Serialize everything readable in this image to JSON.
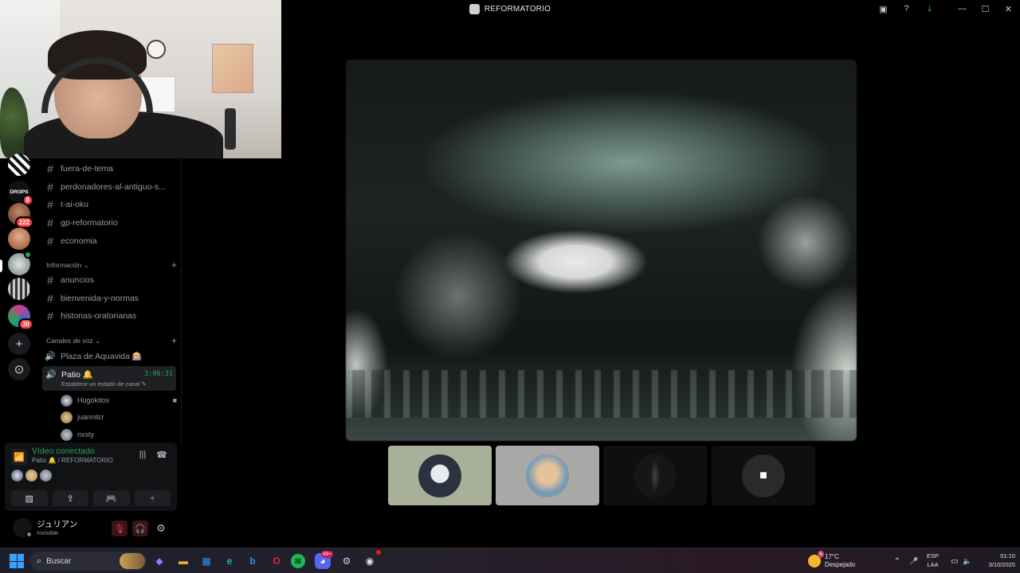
{
  "window": {
    "title": "REFORMATORIO",
    "controls": {
      "inbox": "▣",
      "help": "?",
      "download": "⤓",
      "minimize": "—",
      "maximize": "☐",
      "close": "✕"
    }
  },
  "servers": [
    {
      "name": "server-1",
      "badge": "",
      "color": "#e8e8e8"
    },
    {
      "name": "server-drops",
      "label": "DROPS",
      "badge": "8",
      "color": "#111111"
    },
    {
      "name": "server-3",
      "badge": "222",
      "color": "#a0634a"
    },
    {
      "name": "server-4",
      "badge": "",
      "color": "#b7552c"
    },
    {
      "name": "server-5",
      "badge": "",
      "color": "#9aa6a0",
      "active": true
    },
    {
      "name": "server-6",
      "badge": "",
      "color": "#6b6b6b"
    },
    {
      "name": "server-7",
      "badge": "30",
      "color": "#7b3b8a"
    }
  ],
  "rail_buttons": {
    "add": "+",
    "explore": "⊙"
  },
  "channels_top": [
    {
      "name": "fuera-de-tema"
    },
    {
      "name": "perdonadores-al-antiguo-s..."
    },
    {
      "name": "t-ai-oku"
    },
    {
      "name": "gp-reformatorio"
    },
    {
      "name": "economia"
    }
  ],
  "category_info": {
    "label": "Información ⌄",
    "plus": "+"
  },
  "channels_info": [
    {
      "name": "anuncios"
    },
    {
      "name": "bienvenida-y-normas"
    },
    {
      "name": "historias-oratorianas"
    }
  ],
  "category_voice": {
    "label": "Canales de voz ⌄",
    "plus": "+"
  },
  "voice_channels": [
    {
      "name": "Plaza de Aquavida 🎰"
    }
  ],
  "active_voice": {
    "name": "Patio 🔔",
    "timer": "3:06:31",
    "status": "Establece un estado de canal ✎",
    "users": [
      {
        "name": "Hugokitos",
        "camera": true,
        "color": "#3a4a6a"
      },
      {
        "name": "juannilcr",
        "camera": false,
        "color": "#a88a5a"
      },
      {
        "name": "nxsty",
        "camera": false,
        "color": "#5a6a7a"
      }
    ]
  },
  "voice_panel": {
    "title": "Vídeo conectado",
    "subtitle": "Patio 🔔 / REFORMATORIO",
    "signal_icon": "📶",
    "noise_icon": "|||",
    "disconnect_icon": "☎",
    "avatars": [
      "#3a4a6a",
      "#a88a5a",
      "#5a6a7a"
    ],
    "buttons": [
      {
        "name": "camera-off-button",
        "icon": "▨"
      },
      {
        "name": "share-screen-button",
        "icon": "⇪"
      },
      {
        "name": "activities-button",
        "icon": "🎮"
      },
      {
        "name": "soundboard-button",
        "icon": "✦",
        "dim": true
      }
    ]
  },
  "user": {
    "name": "ジュリアン",
    "status": "Invisible",
    "mic_icon": "🎙",
    "deafen_icon": "🎧",
    "settings_icon": "⚙"
  },
  "stage": {
    "description_hidden": ""
  },
  "tiles": [
    {
      "name": "tile-1",
      "bg": "#a9b09a",
      "avatar": "#2b3340"
    },
    {
      "name": "tile-2",
      "bg": "#a8a8a6",
      "avatar": "#c69a6a"
    },
    {
      "name": "tile-3",
      "bg": "#0f0f0f",
      "avatar": "#161616"
    },
    {
      "name": "tile-4",
      "bg": "#0f0f0f",
      "avatar": "#2a2a2a",
      "icon": "■"
    }
  ],
  "taskbar": {
    "search_placeholder": "Buscar",
    "apps": [
      {
        "name": "copilot",
        "icon": "◆",
        "color": "#6a5cff"
      },
      {
        "name": "file-explorer",
        "icon": "▬",
        "color": "#e8b430"
      },
      {
        "name": "store",
        "icon": "▦",
        "color": "#3a8ee6"
      },
      {
        "name": "edge",
        "icon": "e",
        "color": "#1aa3a3"
      },
      {
        "name": "bing",
        "icon": "b",
        "color": "#2a7fd6"
      },
      {
        "name": "opera",
        "icon": "O",
        "color": "#d1243a"
      },
      {
        "name": "spotify",
        "icon": "≋",
        "color": "#1db954"
      },
      {
        "name": "discord",
        "icon": "◕",
        "color": "#5865f2",
        "badge": "99+"
      },
      {
        "name": "steam",
        "icon": "⚙",
        "color": "#1b2838"
      },
      {
        "name": "obs",
        "icon": "◉",
        "color": "#3a3a3a"
      }
    ],
    "weather": {
      "badge": "6",
      "temp": "17°C",
      "desc": "Despejado"
    },
    "tray": {
      "chevron": "⌃",
      "mic": "🎤",
      "network": "▭",
      "volume": "🔈"
    },
    "lang": {
      "line1": "ESP",
      "line2": "LAA"
    },
    "clock": {
      "time": "01:10",
      "date": "3/10/2025"
    }
  }
}
